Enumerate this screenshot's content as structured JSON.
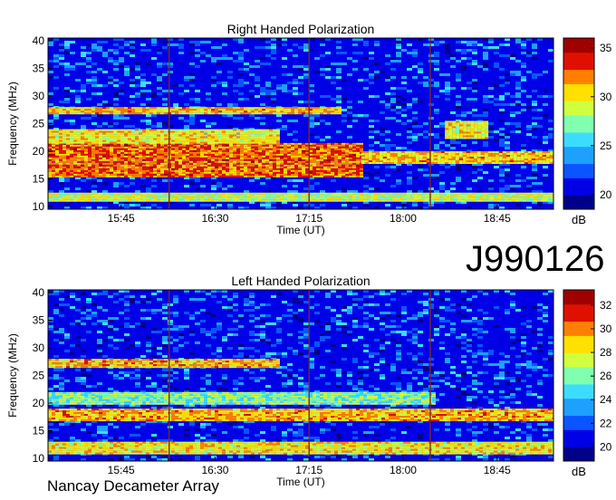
{
  "page": {
    "event_id": "J990126",
    "footer": "Nancay Decameter Array"
  },
  "palette": [
    "#00008b",
    "#0000e6",
    "#0a55ff",
    "#1ea0ff",
    "#3cdcff",
    "#80ffb0",
    "#d0ff40",
    "#ffe000",
    "#ff8000",
    "#e01000",
    "#a00000"
  ],
  "chart_data": [
    {
      "type": "heatmap",
      "title": "Right Handed Polarization",
      "xlabel": "Time (UT)",
      "ylabel": "Frequency (MHz)",
      "xticks": [
        "15:45",
        "16:30",
        "17:15",
        "18:00",
        "18:45"
      ],
      "xlim": [
        "15:10",
        "19:12"
      ],
      "yticks": [
        10,
        15,
        20,
        25,
        30,
        35,
        40
      ],
      "ylim": [
        9.5,
        40.5
      ],
      "colorbar": {
        "label": "dB",
        "ticks": [
          20,
          25,
          30,
          35
        ],
        "range": [
          18.5,
          36
        ]
      },
      "emission_bands": [
        {
          "freq_mhz": [
            15.5,
            21.5
          ],
          "time": [
            "15:10",
            "17:40"
          ],
          "level_db": 34.5
        },
        {
          "freq_mhz": [
            21.5,
            24
          ],
          "time": [
            "15:10",
            "17:00"
          ],
          "level_db": 32
        },
        {
          "freq_mhz": [
            27,
            28
          ],
          "time": [
            "15:10",
            "17:30"
          ],
          "level_db": 33
        },
        {
          "freq_mhz": [
            18,
            20
          ],
          "time": [
            "17:40",
            "19:12"
          ],
          "level_db": 33
        },
        {
          "freq_mhz": [
            22.5,
            25.5
          ],
          "time": [
            "18:20",
            "18:40"
          ],
          "level_db": 32
        },
        {
          "freq_mhz": [
            11,
            12.5
          ],
          "time": [
            "15:10",
            "19:12"
          ],
          "level_db": 31
        }
      ],
      "time_lines": [
        "16:08",
        "17:15",
        "18:13"
      ]
    },
    {
      "type": "heatmap",
      "title": "Left Handed Polarization",
      "xlabel": "Time (UT)",
      "ylabel": "Frequency (MHz)",
      "xticks": [
        "15:45",
        "16:30",
        "17:15",
        "18:00",
        "18:45"
      ],
      "xlim": [
        "15:10",
        "19:12"
      ],
      "yticks": [
        10,
        15,
        20,
        25,
        30,
        35,
        40
      ],
      "ylim": [
        9.5,
        40.5
      ],
      "colorbar": {
        "label": "dB",
        "ticks": [
          20,
          22,
          24,
          26,
          28,
          30,
          32
        ],
        "range": [
          18.8,
          33.3
        ]
      },
      "emission_bands": [
        {
          "freq_mhz": [
            26.5,
            28
          ],
          "time": [
            "15:10",
            "17:00"
          ],
          "level_db": 31
        },
        {
          "freq_mhz": [
            17,
            19
          ],
          "time": [
            "15:10",
            "19:12"
          ],
          "level_db": 31
        },
        {
          "freq_mhz": [
            11,
            13
          ],
          "time": [
            "15:10",
            "19:12"
          ],
          "level_db": 30
        },
        {
          "freq_mhz": [
            20,
            22
          ],
          "time": [
            "15:10",
            "18:15"
          ],
          "level_db": 28
        }
      ],
      "time_lines": [
        "16:08",
        "17:15",
        "18:13"
      ]
    }
  ]
}
